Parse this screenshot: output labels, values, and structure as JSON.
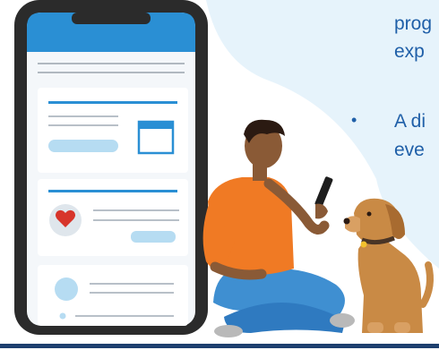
{
  "bullets": {
    "line1": "prog",
    "line2": "exp",
    "line3": "A di",
    "line4": "eve",
    "dot": "•"
  },
  "colors": {
    "text": "#1f5fa8",
    "background_shape": "#e6f3fb",
    "phone_frame": "#2b2b2b",
    "phone_header": "#2a8fd4",
    "accent_light": "#b6dcf2",
    "heart": "#d7352b",
    "shirt": "#f07a24",
    "jeans": "#3f8fd1",
    "dog": "#c98a45",
    "bottom_bar": "#1d3f6e"
  },
  "icons": [
    "phone-illustration",
    "heart-icon",
    "image-placeholder-icon",
    "avatar-circle-icon",
    "smartphone-icon"
  ]
}
